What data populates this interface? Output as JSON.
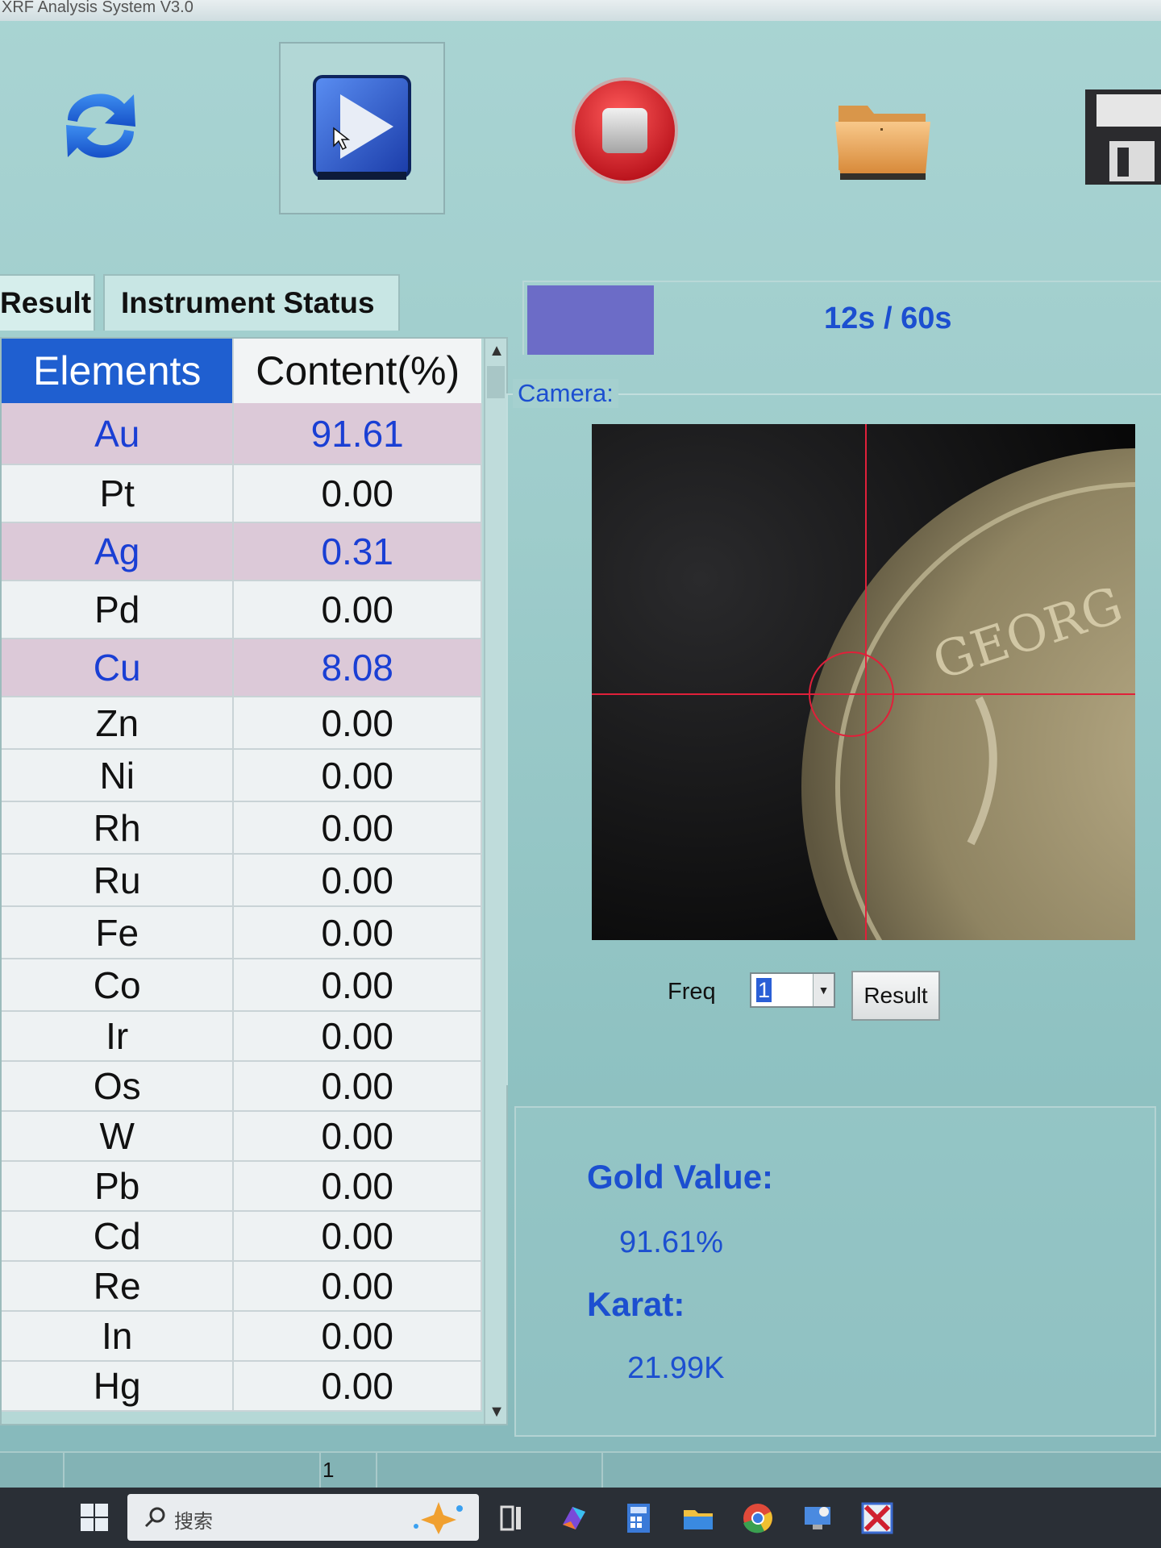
{
  "window": {
    "title": "XRF Analysis System V3.0"
  },
  "toolbar": {
    "refresh_icon": "refresh-icon",
    "start_icon": "play-icon",
    "stop_icon": "stop-icon",
    "open_icon": "folder-icon",
    "save_icon": "floppy-icon"
  },
  "tabs": [
    {
      "label": "Result"
    },
    {
      "label": "Instrument Status"
    }
  ],
  "progress": {
    "elapsed": 12,
    "total": 60,
    "text": "12s / 60s"
  },
  "table": {
    "headers": [
      "Elements",
      "Content(%)"
    ],
    "rows": [
      {
        "element": "Au",
        "content": "91.61",
        "highlight": true
      },
      {
        "element": "Pt",
        "content": "0.00",
        "highlight": false
      },
      {
        "element": "Ag",
        "content": "0.31",
        "highlight": true
      },
      {
        "element": "Pd",
        "content": "0.00",
        "highlight": false
      },
      {
        "element": "Cu",
        "content": "8.08",
        "highlight": true
      },
      {
        "element": "Zn",
        "content": "0.00",
        "highlight": false
      },
      {
        "element": "Ni",
        "content": "0.00",
        "highlight": false
      },
      {
        "element": "Rh",
        "content": "0.00",
        "highlight": false
      },
      {
        "element": "Ru",
        "content": "0.00",
        "highlight": false
      },
      {
        "element": "Fe",
        "content": "0.00",
        "highlight": false
      },
      {
        "element": "Co",
        "content": "0.00",
        "highlight": false
      },
      {
        "element": "Ir",
        "content": "0.00",
        "highlight": false
      },
      {
        "element": "Os",
        "content": "0.00",
        "highlight": false
      },
      {
        "element": "W",
        "content": "0.00",
        "highlight": false
      },
      {
        "element": "Pb",
        "content": "0.00",
        "highlight": false
      },
      {
        "element": "Cd",
        "content": "0.00",
        "highlight": false
      },
      {
        "element": "Re",
        "content": "0.00",
        "highlight": false
      },
      {
        "element": "In",
        "content": "0.00",
        "highlight": false
      },
      {
        "element": "Hg",
        "content": "0.00",
        "highlight": false
      }
    ]
  },
  "camera": {
    "label": "Camera:",
    "coin_text": "GEORG"
  },
  "freq": {
    "label": "Freq",
    "value": "1"
  },
  "result_button": {
    "label": "Result"
  },
  "gold": {
    "value_label": "Gold Value:",
    "value": "91.61%",
    "karat_label": "Karat:",
    "karat": "21.99K"
  },
  "statusbar": {
    "page": "1"
  },
  "taskbar": {
    "search_text": "搜索"
  },
  "colors": {
    "accent_blue": "#1c4fd0",
    "header_blue": "#1f5fd0",
    "highlight_row": "#dcc9d8",
    "progress_fill": "#6c6cc7",
    "crosshair": "#e0203a"
  }
}
